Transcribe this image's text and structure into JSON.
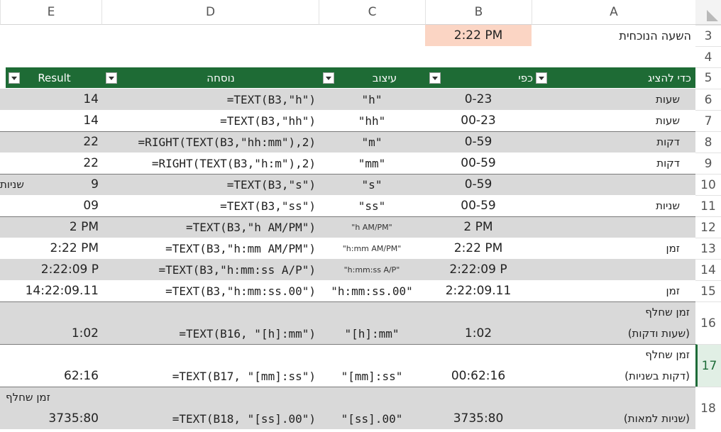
{
  "columns": [
    "E",
    "D",
    "C",
    "B",
    "A"
  ],
  "row3": {
    "label": "השעה הנוכחית",
    "time": "2:22 PM"
  },
  "header": {
    "want": "כדי להציג",
    "use": "כפי",
    "format": "עיצוב",
    "formula": "נוסחה",
    "result": "Result"
  },
  "rows": [
    {
      "num": "6",
      "a": "שעות",
      "b": "0-23",
      "c": "\"h\"",
      "d": "=TEXT(B3,\"h\")",
      "e": "14"
    },
    {
      "num": "7",
      "a": "שעות",
      "b": "00-23",
      "c": "\"hh\"",
      "d": "=TEXT(B3,\"hh\")",
      "e": "14"
    },
    {
      "num": "8",
      "a": "דקות",
      "b": "0-59",
      "c": "\"m\"",
      "d": "=RIGHT(TEXT(B3,\"hh:mm\"),2)",
      "e": "22"
    },
    {
      "num": "9",
      "a": "דקות",
      "b": "00-59",
      "c": "\"mm\"",
      "d": "=RIGHT(TEXT(B3,\"h:m\"),2)",
      "e": "22"
    },
    {
      "num": "10",
      "a": "",
      "b": "0-59",
      "c": "\"s\"",
      "d": "=TEXT(B3,\"s\")",
      "e": "9",
      "overflow": "שניות"
    },
    {
      "num": "11",
      "a": "שניות",
      "b": "00-59",
      "c": "\"ss\"",
      "d": "=TEXT(B3,\"ss\")",
      "e": "09"
    },
    {
      "num": "12",
      "a": "",
      "b": "2 PM",
      "c": "\"h AM/PM\"",
      "d": "=TEXT(B3,\"h AM/PM\")",
      "e": "2 PM"
    },
    {
      "num": "13",
      "a": "זמן",
      "b": "2:22 PM",
      "c": "\"h:mm AM/PM\"",
      "d": "=TEXT(B3,\"h:mm AM/PM\")",
      "e": "2:22 PM"
    },
    {
      "num": "14",
      "a": "",
      "b": "2:22:09 P",
      "c": "\"h:mm:ss A/P\"",
      "d": "=TEXT(B3,\"h:mm:ss A/P\")",
      "e": "2:22:09 P"
    },
    {
      "num": "15",
      "a": "זמן",
      "b": "2:22:09.11",
      "c": "\"h:mm:ss.00\"",
      "d": "=TEXT(B3,\"h:mm:ss.00\")",
      "e": "14:22:09.11"
    },
    {
      "num": "16",
      "a1": "זמן שחלף",
      "a2": "(שעות ודקות)",
      "b": "1:02",
      "c": "\"[h]:mm\"",
      "d": "=TEXT(B16, \"[h]:mm\")",
      "e": "1:02"
    },
    {
      "num": "17",
      "a1": "זמן שחלף",
      "a2": "(דקות בשניות)",
      "b": "00:62:16",
      "c": "\"[mm]:ss\"",
      "d": "=TEXT(B17, \"[mm]:ss\")",
      "e": "62:16"
    },
    {
      "num": "18",
      "a1": "זמן שחלף",
      "a2": "(שניות למאות)",
      "b": "3735:80",
      "c": "\"[ss].00\"",
      "d": "=TEXT(B18, \"[ss].00\")",
      "e": "3735:80"
    }
  ],
  "row_numbers_top": [
    "3",
    "4",
    "5"
  ],
  "colors": {
    "header_green": "#1e6b35",
    "band_gray": "#d9d9d9",
    "highlight": "#fbd5c4"
  }
}
